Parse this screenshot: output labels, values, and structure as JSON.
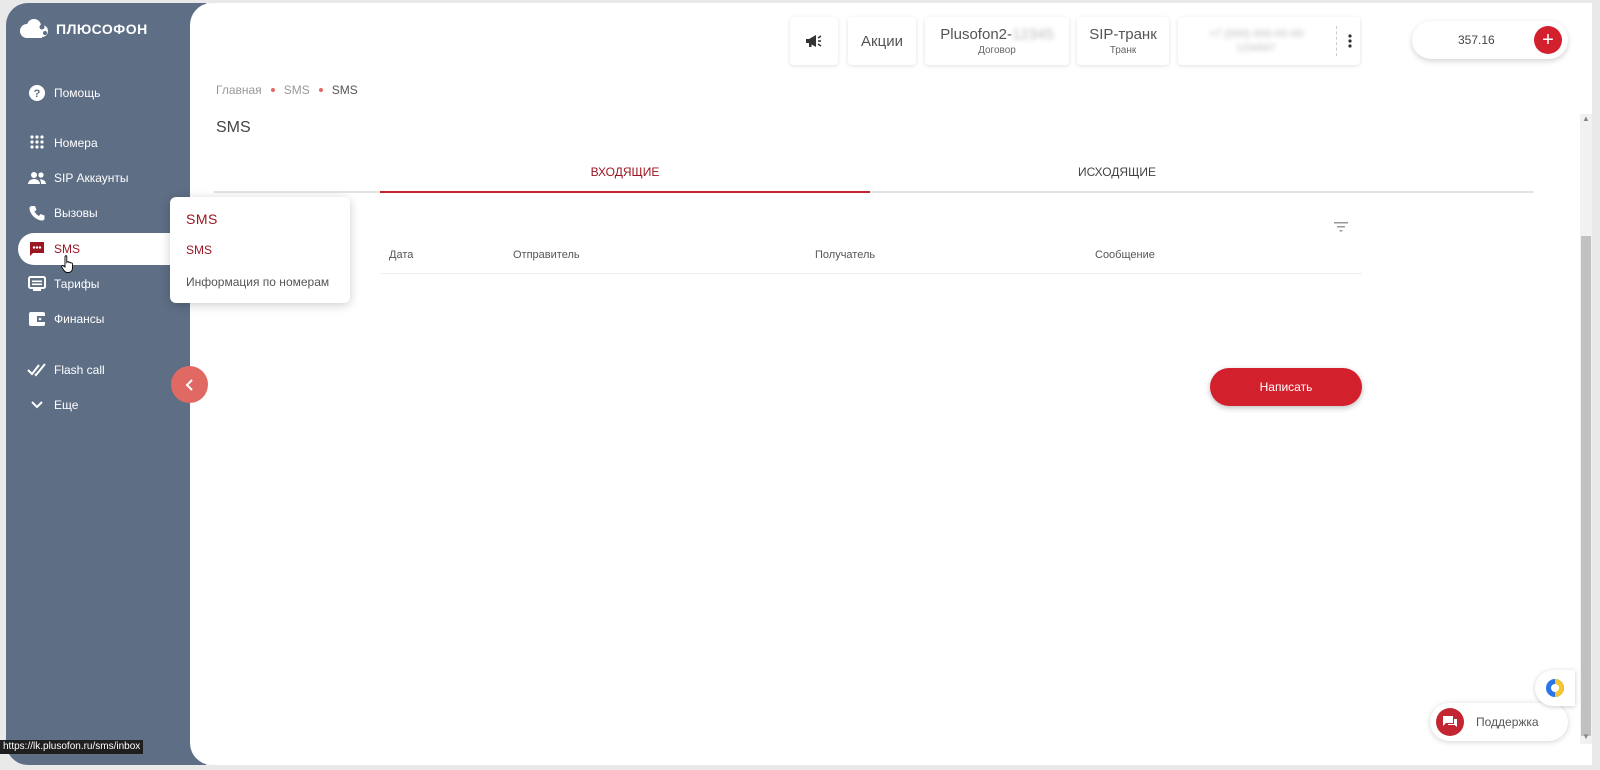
{
  "brand": {
    "name": "ПЛЮСОФОН"
  },
  "sidebar": {
    "items": [
      {
        "label": "Помощь",
        "icon": "help-icon"
      },
      {
        "label": "Номера",
        "icon": "dialpad-icon"
      },
      {
        "label": "SIP Аккаунты",
        "icon": "people-icon"
      },
      {
        "label": "Вызовы",
        "icon": "phone-icon"
      },
      {
        "label": "SMS",
        "icon": "sms-icon",
        "active": true
      },
      {
        "label": "Тарифы",
        "icon": "tariff-icon"
      },
      {
        "label": "Финансы",
        "icon": "wallet-icon"
      },
      {
        "label": "Flash call",
        "icon": "double-check-icon"
      },
      {
        "label": "Еще",
        "icon": "chevron-down-icon"
      }
    ]
  },
  "submenu": {
    "title": "SMS",
    "items": [
      "SMS",
      "Информация по номерам"
    ]
  },
  "topbar": {
    "promo_label": "Акции",
    "account": {
      "name": "Plusofon2-",
      "name_hidden": "12345",
      "sub": "Договор"
    },
    "sip": {
      "label": "SIP-транк",
      "sub": "Транк"
    },
    "phone_hidden": {
      "line1": "+7 (000) 000-00-00",
      "line2": "1234567"
    },
    "balance": "357.16"
  },
  "breadcrumb": [
    "Главная",
    "SMS",
    "SMS"
  ],
  "page": {
    "title": "SMS"
  },
  "tabs": [
    "ВХОДЯЩИЕ",
    "ИСХОДЯЩИЕ"
  ],
  "table": {
    "columns": [
      "Дата",
      "Отправитель",
      "Получатель",
      "Сообщение"
    ]
  },
  "actions": {
    "write": "Написать"
  },
  "support": {
    "label": "Поддержка"
  },
  "status_url": "https://lk.plusofon.ru/sms/inbox",
  "colors": {
    "sidebar": "#5d6e85",
    "accent": "#d3202d",
    "accent_dark": "#9b1622"
  }
}
